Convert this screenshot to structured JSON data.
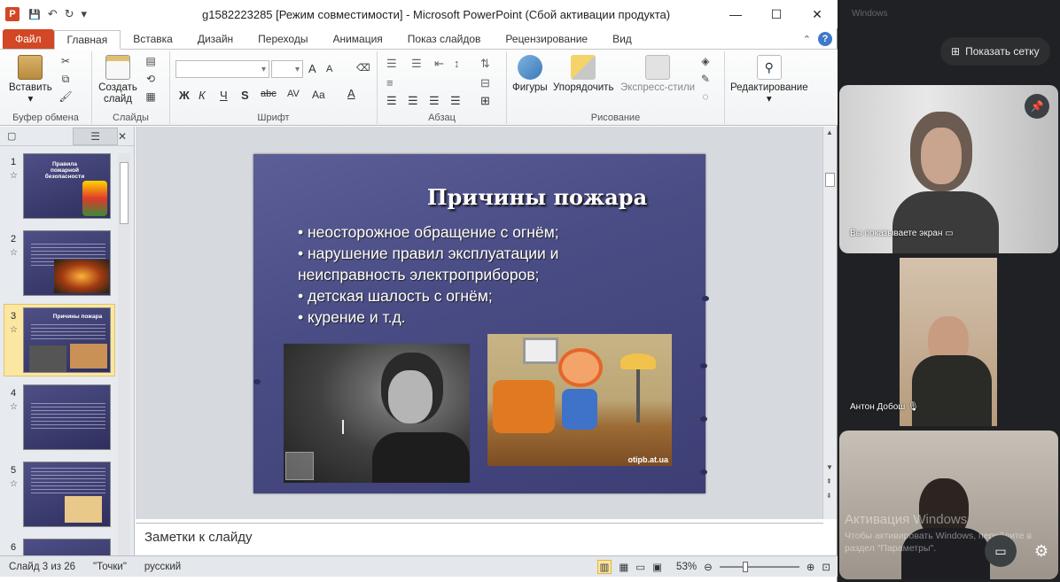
{
  "app": {
    "logo": "P",
    "title": "g1582223285 [Режим совместимости] - Microsoft PowerPoint (Сбой активации продукта)"
  },
  "window": {
    "min": "—",
    "max": "☐",
    "close": "✕"
  },
  "qat": {
    "save": "💾",
    "undo": "↶",
    "redo": "↻",
    "more": "▾"
  },
  "tabs": [
    "Файл",
    "Главная",
    "Вставка",
    "Дизайн",
    "Переходы",
    "Анимация",
    "Показ слайдов",
    "Рецензирование",
    "Вид"
  ],
  "ribbon": {
    "clipboard": {
      "paste": "Вставить",
      "label": "Буфер обмена"
    },
    "slides": {
      "new": "Создать слайд",
      "label": "Слайды"
    },
    "font": {
      "label": "Шрифт",
      "bold": "Ж",
      "italic": "К",
      "underline": "Ч",
      "strike": "S",
      "abc": "abc",
      "grow": "A",
      "shrink": "A",
      "aa": "Aa",
      "fontcolor": "A"
    },
    "paragraph": {
      "label": "Абзац"
    },
    "drawing": {
      "shapes": "Фигуры",
      "arrange": "Упорядочить",
      "styles": "Экспресс-стили",
      "label": "Рисование"
    },
    "editing": {
      "label": "Редактирование"
    }
  },
  "slides_panel": {
    "items": [
      {
        "num": "1",
        "title": "Правила пожарной безопасности"
      },
      {
        "num": "2",
        "title": ""
      },
      {
        "num": "3",
        "title": "Причины пожара"
      },
      {
        "num": "4",
        "title": ""
      },
      {
        "num": "5",
        "title": ""
      },
      {
        "num": "6",
        "title": ""
      }
    ]
  },
  "slide": {
    "title": "Причины пожара",
    "bullets": [
      "• неосторожное обращение с огнём;",
      "• нарушение правил эксплуатации и неисправность электроприборов;",
      "• детская шалость с огнём;",
      "• курение и т.д."
    ],
    "watermark": "otipb.at.ua"
  },
  "notes": {
    "placeholder": "Заметки к слайду"
  },
  "status": {
    "slide": "Слайд 3 из 26",
    "theme": "\"Точки\"",
    "lang": "русский",
    "zoom": "53%"
  },
  "meet": {
    "show_grid": "Показать сетку",
    "presenting": "Вы показываете экран",
    "participant2": "Антон Добош",
    "activation1": "Активация Windows",
    "activation2": "Чтобы активировать Windows, перейдите в раздел \"Параметры\"."
  },
  "colors": {
    "file_tab": "#d24726",
    "slide_bg": "#4a4c85",
    "selection": "#fbe7a2"
  }
}
